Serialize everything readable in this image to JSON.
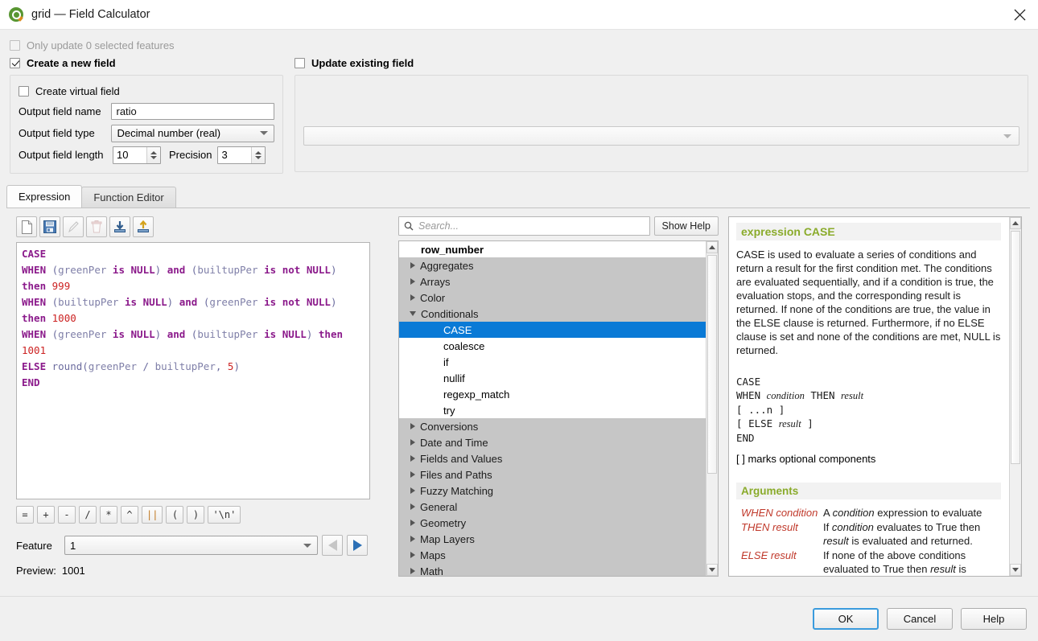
{
  "window": {
    "title": "grid — Field Calculator",
    "logo_icon": "qgis-logo-icon",
    "close_icon": "close-icon"
  },
  "options": {
    "only_update_selected": "Only update 0 selected features",
    "create_new_field": "Create a new field",
    "update_existing_field": "Update existing field",
    "create_virtual_field": "Create virtual field",
    "output_field_name_label": "Output field name",
    "output_field_name_value": "ratio",
    "output_field_type_label": "Output field type",
    "output_field_type_value": "Decimal number (real)",
    "output_field_length_label": "Output field length",
    "output_field_length_value": "10",
    "precision_label": "Precision",
    "precision_value": "3",
    "existing_field_value": ""
  },
  "tabs": [
    {
      "label": "Expression",
      "active": true
    },
    {
      "label": "Function Editor",
      "active": false
    }
  ],
  "toolbar": [
    {
      "name": "new-expression-icon",
      "title": "New"
    },
    {
      "name": "save-expression-icon",
      "title": "Save"
    },
    {
      "name": "edit-expression-icon",
      "title": "Edit"
    },
    {
      "name": "delete-expression-icon",
      "title": "Delete"
    },
    {
      "name": "import-expression-icon",
      "title": "Import"
    },
    {
      "name": "export-expression-icon",
      "title": "Export"
    }
  ],
  "expression": {
    "lines": [
      [
        {
          "t": "CASE",
          "c": "kw"
        }
      ],
      [
        {
          "t": "WHEN",
          "c": "kw"
        },
        {
          "t": " (",
          "c": "op"
        },
        {
          "t": "greenPer",
          "c": "id"
        },
        {
          "t": " ",
          "c": "op"
        },
        {
          "t": "is",
          "c": "kw"
        },
        {
          "t": " ",
          "c": "op"
        },
        {
          "t": "NULL",
          "c": "kw"
        },
        {
          "t": ") ",
          "c": "op"
        },
        {
          "t": "and",
          "c": "kw"
        },
        {
          "t": " (",
          "c": "op"
        },
        {
          "t": "builtupPer",
          "c": "id"
        },
        {
          "t": " ",
          "c": "op"
        },
        {
          "t": "is",
          "c": "kw"
        },
        {
          "t": " ",
          "c": "op"
        },
        {
          "t": "not",
          "c": "kw"
        },
        {
          "t": " ",
          "c": "op"
        },
        {
          "t": "NULL",
          "c": "kw"
        },
        {
          "t": ") ",
          "c": "op"
        },
        {
          "t": "then",
          "c": "kw"
        },
        {
          "t": " ",
          "c": "op"
        },
        {
          "t": "999",
          "c": "num"
        }
      ],
      [
        {
          "t": "WHEN",
          "c": "kw"
        },
        {
          "t": " (",
          "c": "op"
        },
        {
          "t": "builtupPer",
          "c": "id"
        },
        {
          "t": " ",
          "c": "op"
        },
        {
          "t": "is",
          "c": "kw"
        },
        {
          "t": " ",
          "c": "op"
        },
        {
          "t": "NULL",
          "c": "kw"
        },
        {
          "t": ") ",
          "c": "op"
        },
        {
          "t": "and",
          "c": "kw"
        },
        {
          "t": " (",
          "c": "op"
        },
        {
          "t": "greenPer",
          "c": "id"
        },
        {
          "t": " ",
          "c": "op"
        },
        {
          "t": "is",
          "c": "kw"
        },
        {
          "t": " ",
          "c": "op"
        },
        {
          "t": "not",
          "c": "kw"
        },
        {
          "t": " ",
          "c": "op"
        },
        {
          "t": "NULL",
          "c": "kw"
        },
        {
          "t": ") ",
          "c": "op"
        },
        {
          "t": "then",
          "c": "kw"
        },
        {
          "t": " ",
          "c": "op"
        },
        {
          "t": "1000",
          "c": "num"
        }
      ],
      [
        {
          "t": "WHEN",
          "c": "kw"
        },
        {
          "t": " (",
          "c": "op"
        },
        {
          "t": "greenPer",
          "c": "id"
        },
        {
          "t": " ",
          "c": "op"
        },
        {
          "t": "is",
          "c": "kw"
        },
        {
          "t": " ",
          "c": "op"
        },
        {
          "t": "NULL",
          "c": "kw"
        },
        {
          "t": ") ",
          "c": "op"
        },
        {
          "t": "and",
          "c": "kw"
        },
        {
          "t": " (",
          "c": "op"
        },
        {
          "t": "builtupPer",
          "c": "id"
        },
        {
          "t": " ",
          "c": "op"
        },
        {
          "t": "is",
          "c": "kw"
        },
        {
          "t": " ",
          "c": "op"
        },
        {
          "t": "NULL",
          "c": "kw"
        },
        {
          "t": ") ",
          "c": "op"
        },
        {
          "t": "then",
          "c": "kw"
        },
        {
          "t": " ",
          "c": "op"
        },
        {
          "t": "1001",
          "c": "num"
        }
      ],
      [
        {
          "t": "ELSE",
          "c": "kw"
        },
        {
          "t": " round(",
          "c": "op"
        },
        {
          "t": "greenPer",
          "c": "id"
        },
        {
          "t": " / ",
          "c": "op"
        },
        {
          "t": "builtupPer",
          "c": "id"
        },
        {
          "t": ", ",
          "c": "op"
        },
        {
          "t": "5",
          "c": "num"
        },
        {
          "t": ")",
          "c": "op"
        }
      ],
      [
        {
          "t": "END",
          "c": "kw"
        }
      ]
    ],
    "plain": "CASE\nWHEN (greenPer is NULL) and (builtupPer is not NULL) then 999\nWHEN (builtupPer is NULL) and (greenPer is not NULL) then 1000\nWHEN (greenPer is NULL) and (builtupPer is NULL) then 1001\nELSE round(greenPer / builtupPer, 5)\nEND"
  },
  "operators": [
    "=",
    "+",
    "-",
    "/",
    "*",
    "^",
    "||",
    "(",
    ")",
    "'\\n'"
  ],
  "feature": {
    "label": "Feature",
    "value": "1",
    "prev_icon": "previous-feature-icon",
    "next_icon": "next-feature-icon"
  },
  "preview": {
    "label": "Preview:",
    "value": "1001"
  },
  "search": {
    "placeholder": "Search...",
    "icon": "search-icon",
    "show_help_label": "Show Help"
  },
  "function_tree": [
    {
      "label": "row_number",
      "type": "root",
      "expanded": false,
      "selected": false
    },
    {
      "label": "Aggregates",
      "type": "category",
      "expanded": false,
      "selected": false
    },
    {
      "label": "Arrays",
      "type": "category",
      "expanded": false,
      "selected": false
    },
    {
      "label": "Color",
      "type": "category",
      "expanded": false,
      "selected": false
    },
    {
      "label": "Conditionals",
      "type": "category",
      "expanded": true,
      "selected": false
    },
    {
      "label": "CASE",
      "type": "function",
      "expanded": false,
      "selected": true
    },
    {
      "label": "coalesce",
      "type": "function",
      "expanded": false,
      "selected": false
    },
    {
      "label": "if",
      "type": "function",
      "expanded": false,
      "selected": false
    },
    {
      "label": "nullif",
      "type": "function",
      "expanded": false,
      "selected": false
    },
    {
      "label": "regexp_match",
      "type": "function",
      "expanded": false,
      "selected": false
    },
    {
      "label": "try",
      "type": "function",
      "expanded": false,
      "selected": false
    },
    {
      "label": "Conversions",
      "type": "category",
      "expanded": false,
      "selected": false
    },
    {
      "label": "Date and Time",
      "type": "category",
      "expanded": false,
      "selected": false
    },
    {
      "label": "Fields and Values",
      "type": "category",
      "expanded": false,
      "selected": false
    },
    {
      "label": "Files and Paths",
      "type": "category",
      "expanded": false,
      "selected": false
    },
    {
      "label": "Fuzzy Matching",
      "type": "category",
      "expanded": false,
      "selected": false
    },
    {
      "label": "General",
      "type": "category",
      "expanded": false,
      "selected": false
    },
    {
      "label": "Geometry",
      "type": "category",
      "expanded": false,
      "selected": false
    },
    {
      "label": "Map Layers",
      "type": "category",
      "expanded": false,
      "selected": false
    },
    {
      "label": "Maps",
      "type": "category",
      "expanded": false,
      "selected": false
    },
    {
      "label": "Math",
      "type": "category",
      "expanded": false,
      "selected": false
    }
  ],
  "help": {
    "heading": "expression CASE",
    "body": "CASE is used to evaluate a series of conditions and return a result for the first condition met. The conditions are evaluated sequentially, and if a condition is true, the evaluation stops, and the corresponding result is returned. If none of the conditions are true, the value in the ELSE clause is returned. Furthermore, if no ELSE clause is set and none of the conditions are met, NULL is returned.",
    "syntax_lines": [
      "CASE",
      "WHEN condition THEN result",
      "[ ...n ]",
      "[ ELSE result ]",
      "END"
    ],
    "optional_note": "[ ] marks optional components",
    "arguments_heading": "Arguments",
    "arguments": [
      {
        "name": "WHEN condition",
        "desc": "A condition expression to evaluate"
      },
      {
        "name": "THEN result",
        "desc": "If condition evaluates to True then result is evaluated and returned."
      },
      {
        "name": "ELSE result",
        "desc": "If none of the above conditions evaluated to True then result is evaluated and returned."
      }
    ]
  },
  "footer": {
    "ok": "OK",
    "cancel": "Cancel",
    "help": "Help"
  },
  "colors": {
    "selection_blue": "#0a7ad6",
    "help_heading_green": "#8aab2b",
    "keyword_purple": "#8b1a8b",
    "number_red": "#cc2222",
    "argument_red": "#c0392b"
  }
}
